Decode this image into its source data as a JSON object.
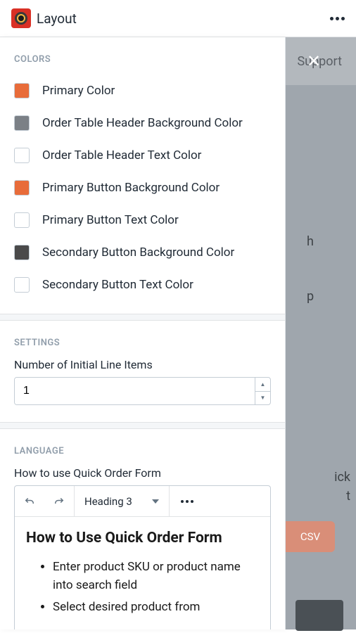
{
  "header": {
    "title": "Layout"
  },
  "rightPane": {
    "support": "Support",
    "csv": "CSV",
    "partial_h": "h",
    "partial_p": "p",
    "partial_quick": "ick",
    "partial_t": "t"
  },
  "sections": {
    "colors": {
      "title": "Colors",
      "items": [
        {
          "label": "Primary Color",
          "swatchClass": "swatch-orange"
        },
        {
          "label": "Order Table Header Background Color",
          "swatchClass": "swatch-gray"
        },
        {
          "label": "Order Table Header Text Color",
          "swatchClass": "swatch-white"
        },
        {
          "label": "Primary Button Background Color",
          "swatchClass": "swatch-orange"
        },
        {
          "label": "Primary Button Text Color",
          "swatchClass": "swatch-white"
        },
        {
          "label": "Secondary Button Background Color",
          "swatchClass": "swatch-dark"
        },
        {
          "label": "Secondary Button Text Color",
          "swatchClass": "swatch-white"
        }
      ]
    },
    "settings": {
      "title": "Settings",
      "lineItemsLabel": "Number of Initial Line Items",
      "lineItemsValue": "1"
    },
    "language": {
      "title": "Language",
      "howtoLabel": "How to use Quick Order Form",
      "headingDropdown": "Heading 3",
      "content": {
        "heading": "How to Use Quick Order Form",
        "bullets": [
          "Enter product SKU or product name into search field",
          "Select desired product from"
        ]
      }
    }
  }
}
